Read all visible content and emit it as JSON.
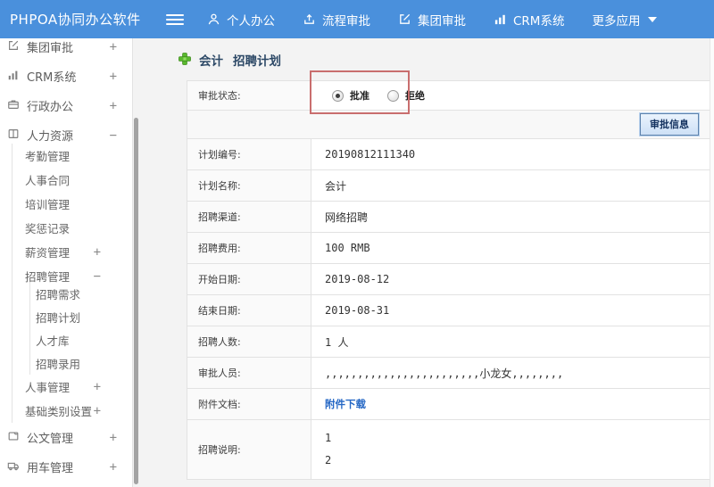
{
  "colors": {
    "topbar-blue": "#4a90dc",
    "highlight-red": "#c96e6e",
    "link-blue": "#2668c5",
    "title-navy": "#2c4866",
    "plus-green": "#57b32c"
  },
  "topbar": {
    "logo": "PHPOA协同办公软件",
    "nav": [
      {
        "label": "个人办公",
        "icon": "person-icon"
      },
      {
        "label": "流程审批",
        "icon": "flow-icon"
      },
      {
        "label": "集团审批",
        "icon": "edit-icon"
      },
      {
        "label": "CRM系统",
        "icon": "chart-icon"
      },
      {
        "label": "更多应用",
        "icon": "caret-down-icon"
      }
    ]
  },
  "sidebar": {
    "items": [
      {
        "label": "集团审批",
        "expand": "+",
        "icon": "edit-square-icon"
      },
      {
        "label": "CRM系统",
        "expand": "+",
        "icon": "bar-chart-icon"
      },
      {
        "label": "行政办公",
        "expand": "+",
        "icon": "briefcase-icon"
      },
      {
        "label": "人力资源",
        "expand": "−",
        "icon": "book-icon"
      },
      {
        "label": "考勤管理"
      },
      {
        "label": "人事合同"
      },
      {
        "label": "培训管理"
      },
      {
        "label": "奖惩记录"
      },
      {
        "label": "薪资管理",
        "expand": "+"
      },
      {
        "label": "招聘管理",
        "expand": "−"
      },
      {
        "label": "招聘需求"
      },
      {
        "label": "招聘计划"
      },
      {
        "label": "人才库"
      },
      {
        "label": "招聘录用"
      },
      {
        "label": "人事管理",
        "expand": "+"
      },
      {
        "label": "基础类别设置",
        "expand": "+"
      },
      {
        "label": "公文管理",
        "expand": "+",
        "icon": "document-icon"
      },
      {
        "label": "用车管理",
        "expand": "+",
        "icon": "truck-icon"
      }
    ]
  },
  "main": {
    "title_name": "会计",
    "title_type": "招聘计划",
    "form": {
      "status_label": "审批状态:",
      "radio_approve": "批准",
      "radio_reject": "拒绝",
      "approve_info_button": "审批信息",
      "rows": [
        {
          "label": "计划编号:",
          "value": "20190812111340"
        },
        {
          "label": "计划名称:",
          "value": "会计"
        },
        {
          "label": "招聘渠道:",
          "value": "网络招聘"
        },
        {
          "label": "招聘费用:",
          "value": "100 RMB"
        },
        {
          "label": "开始日期:",
          "value": "2019-08-12"
        },
        {
          "label": "结束日期:",
          "value": "2019-08-31"
        },
        {
          "label": "招聘人数:",
          "value": "1 人"
        },
        {
          "label": "审批人员:",
          "value": ",,,,,,,,,,,,,,,,,,,,,,,,小龙女,,,,,,,,"
        },
        {
          "label": "附件文档:",
          "value": "附件下载"
        },
        {
          "label": "招聘说明:",
          "line1": "1",
          "line2": "2"
        }
      ]
    }
  }
}
